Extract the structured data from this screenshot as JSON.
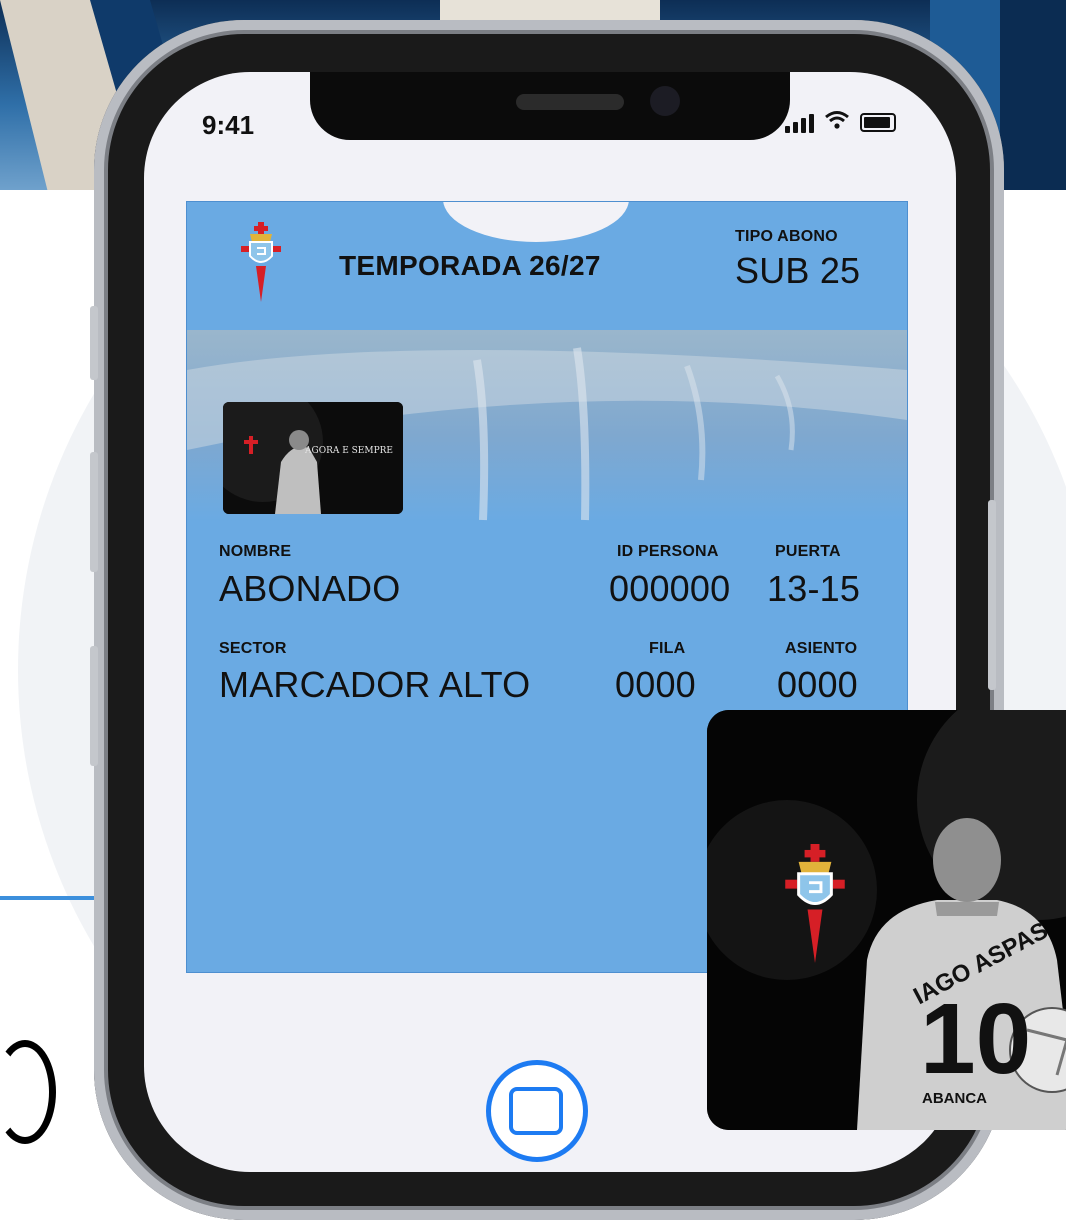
{
  "status_bar": {
    "time": "9:41"
  },
  "pass": {
    "season": "TEMPORADA 26/27",
    "tipo_label": "TIPO ABONO",
    "tipo_value": "SUB 25",
    "mini_card_text": "AGORA E SEMPRE",
    "fields": {
      "nombre_label": "NOMBRE",
      "nombre_value": "ABONADO",
      "id_label": "ID PERSONA",
      "id_value": "000000",
      "puerta_label": "PUERTA",
      "puerta_value": "13-15",
      "sector_label": "SECTOR",
      "sector_value": "MARCADOR ALTO",
      "fila_label": "FILA",
      "fila_value": "0000",
      "asiento_label": "ASIENTO",
      "asiento_value": "0000"
    }
  },
  "promo": {
    "player_name": "IAGO ASPAS",
    "number": "10",
    "sponsor": "ABANCA"
  },
  "colors": {
    "pass_blue": "#6aaae3",
    "crest_red": "#d61f26",
    "crest_blue": "#8ec5ea",
    "wallet_blue": "#1d7bf2"
  },
  "icons": [
    "celta-crest-icon",
    "signal-icon",
    "wifi-icon",
    "battery-icon",
    "wallet-icon"
  ]
}
